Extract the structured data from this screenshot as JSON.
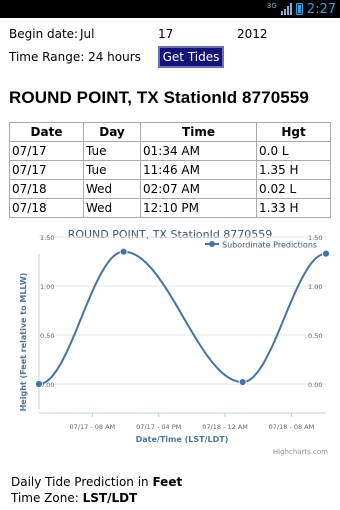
{
  "status_bar": {
    "network": "3G",
    "time": "2:27"
  },
  "form": {
    "begin_date_label": "Begin date:",
    "month": "Jul",
    "day": "17",
    "year": "2012",
    "time_range_label": "Time Range:",
    "time_range_value": "24 hours",
    "button_label": "Get Tides"
  },
  "station_title": "ROUND POINT, TX StationId 8770559",
  "table": {
    "headers": [
      "Date",
      "Day",
      "Time",
      "Hgt"
    ],
    "rows": [
      [
        "07/17",
        "Tue",
        "01:34 AM",
        "0.0 L"
      ],
      [
        "07/17",
        "Tue",
        "11:46 AM",
        "1.35 H"
      ],
      [
        "07/18",
        "Wed",
        "02:07 AM",
        "0.02 L"
      ],
      [
        "07/18",
        "Wed",
        "12:10 PM",
        "1.33 H"
      ]
    ]
  },
  "chart_data": {
    "type": "line",
    "title": "ROUND POINT, TX StationId 8770559",
    "legend": "Subordinate Predictions",
    "legend_position": "top-right",
    "xlabel": "Date/Time (LST/LDT)",
    "ylabel": "Height (Feet relative to MLLW)",
    "x_ticks": [
      "07/17 - 08 AM",
      "07/17 - 04 PM",
      "07/18 - 12 AM",
      "07/18 - 08 AM"
    ],
    "y_ticks": [
      "1.50",
      "1.00",
      "0.50",
      "0.00"
    ],
    "y_ticks_right": [
      "1.50",
      "1.00",
      "0.50",
      "0.00"
    ],
    "ylim": [
      0,
      1.5
    ],
    "xlim": [
      "07/17 01:34 AM",
      "07/18 12:10 PM"
    ],
    "grid": true,
    "series": [
      {
        "name": "Subordinate Predictions",
        "color": "#4572a7",
        "points": [
          {
            "x": "07/17 01:34 AM",
            "y": 0.0
          },
          {
            "x": "07/17 11:46 AM",
            "y": 1.35
          },
          {
            "x": "07/18 02:07 AM",
            "y": 0.02
          },
          {
            "x": "07/18 12:10 PM",
            "y": 1.33
          }
        ]
      }
    ],
    "credit": "Highcharts.com"
  },
  "footer": {
    "line1_prefix": "Daily Tide Prediction in ",
    "line1_unit": "Feet",
    "line2_prefix": "Time Zone: ",
    "line2_value": "LST/LDT"
  }
}
